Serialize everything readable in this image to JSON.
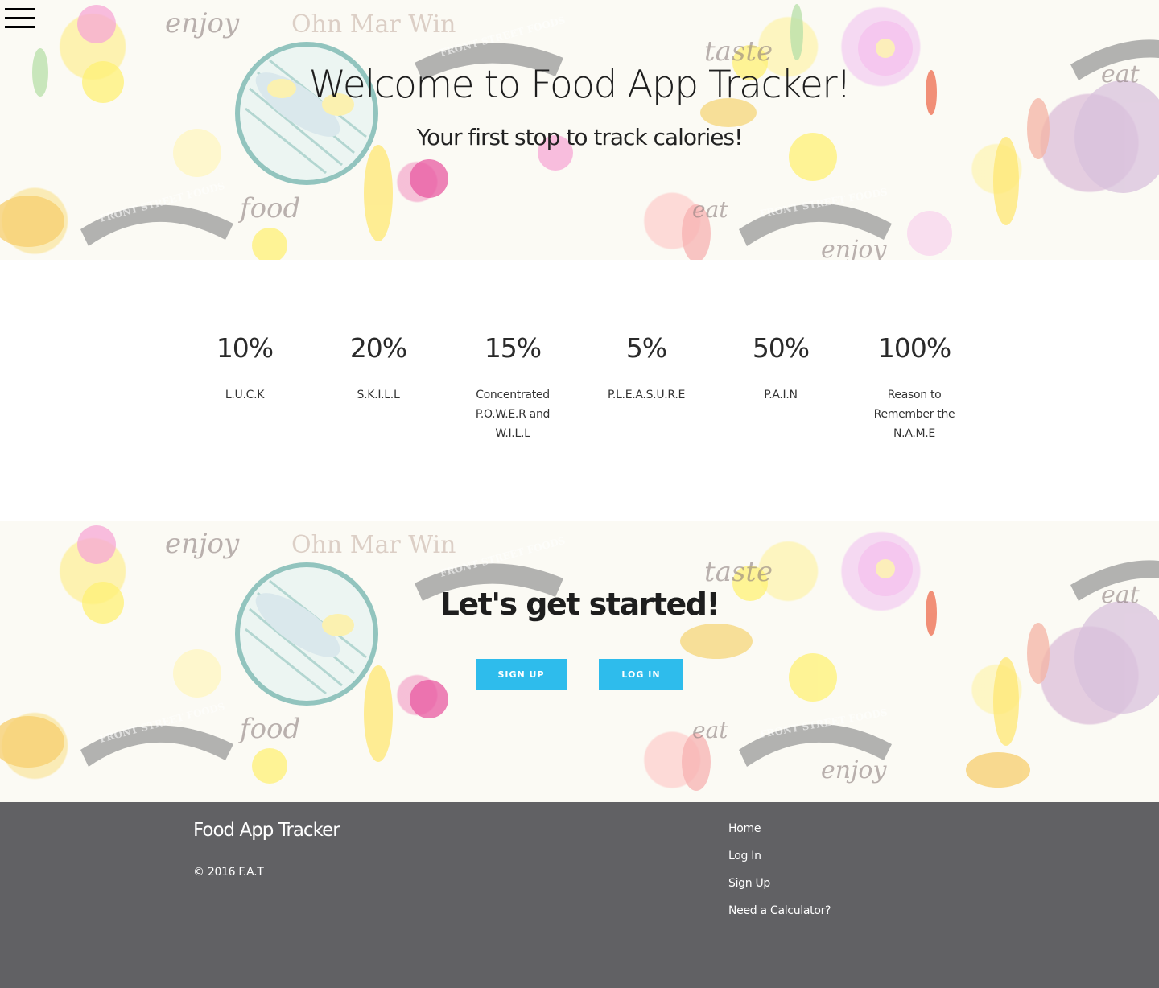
{
  "header": {
    "menu_icon": "hamburger-menu-icon",
    "title": "Welcome to Food App Tracker!",
    "subtitle": "Your first stop to track calories!"
  },
  "background_decoration": {
    "words": [
      "enjoy",
      "taste",
      "eat",
      "food",
      "eat",
      "enjoy"
    ],
    "banner_text": "FRONT STREET FOODS",
    "signature": "Ohn Mar Win"
  },
  "stats": [
    {
      "value": "10%",
      "label": "L.U.C.K"
    },
    {
      "value": "20%",
      "label": "S.K.I.L.L"
    },
    {
      "value": "15%",
      "label": "Concentrated P.O.W.E.R and W.I.L.L"
    },
    {
      "value": "5%",
      "label": "P.L.E.A.S.U.R.E"
    },
    {
      "value": "50%",
      "label": "P.A.I.N"
    },
    {
      "value": "100%",
      "label": "Reason to Remember the N.A.M.E"
    }
  ],
  "cta": {
    "title": "Let's get started!",
    "signup_label": "SIGN UP",
    "login_label": "LOG IN"
  },
  "footer": {
    "brand": "Food App Tracker",
    "copyright": "© 2016 F.A.T",
    "links": [
      "Home",
      "Log In",
      "Sign Up",
      "Need a Calculator?"
    ]
  },
  "colors": {
    "button": "#2ebcec",
    "footer_bg": "#616164"
  }
}
